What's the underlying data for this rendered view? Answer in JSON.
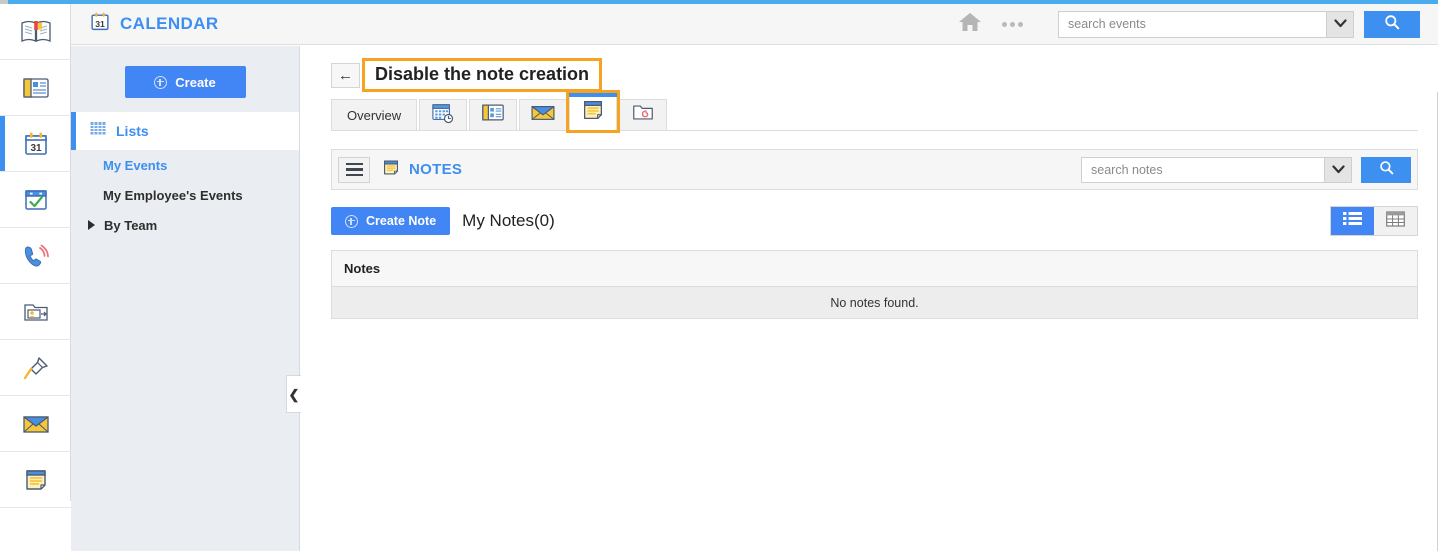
{
  "theme": {
    "accent_blue": "#3d8ff0",
    "button_blue": "#4285f4",
    "top_strip_blue": "#4aaced",
    "highlight_orange": "#f5a321",
    "sidebar_bg": "#eaedf2"
  },
  "rail": {
    "items": [
      {
        "icon": "open-book-icon",
        "active": false
      },
      {
        "icon": "news-article-icon",
        "active": false
      },
      {
        "icon": "calendar-31-icon",
        "active": true
      },
      {
        "icon": "calendar-check-icon",
        "active": false
      },
      {
        "icon": "phone-ringing-icon",
        "active": false
      },
      {
        "icon": "contact-folder-icon",
        "active": false
      },
      {
        "icon": "pushpin-icon",
        "active": false
      },
      {
        "icon": "envelope-icon",
        "active": false
      },
      {
        "icon": "notes-icon",
        "active": false
      }
    ]
  },
  "header": {
    "logo_icon": "calendar-31-icon",
    "title": "CALENDAR",
    "home_icon": "home-icon",
    "more_icon": "more-dots-icon",
    "search": {
      "placeholder": "search events",
      "value": "",
      "caret_icon": "chevron-down-icon",
      "go_icon": "search-icon"
    }
  },
  "sidebar": {
    "create_label": "Create",
    "section": {
      "icon": "grid-icon",
      "label": "Lists"
    },
    "items": [
      {
        "label": "My Events",
        "selected": true
      },
      {
        "label": "My Employee's Events",
        "selected": false
      },
      {
        "label": "By Team",
        "selected": false,
        "expandable": true
      }
    ],
    "collapse_icon": "chevron-left-icon"
  },
  "main": {
    "back_icon": "back-arrow-icon",
    "page_title": "Disable the note creation",
    "tabs": [
      {
        "label": "Overview",
        "icon": null,
        "type": "text",
        "active": false,
        "highlighted": false
      },
      {
        "label": "",
        "icon": "calendar-clock-icon",
        "type": "icon",
        "active": false,
        "highlighted": false
      },
      {
        "label": "",
        "icon": "details-list-icon",
        "type": "icon",
        "active": false,
        "highlighted": false
      },
      {
        "label": "",
        "icon": "envelope-icon",
        "type": "icon",
        "active": false,
        "highlighted": false
      },
      {
        "label": "",
        "icon": "notes-icon",
        "type": "icon",
        "active": true,
        "highlighted": true
      },
      {
        "label": "",
        "icon": "attachment-folder-icon",
        "type": "icon",
        "active": false,
        "highlighted": false
      }
    ],
    "module": {
      "burger_icon": "hamburger-menu-icon",
      "icon": "notes-icon",
      "title": "NOTES",
      "search": {
        "placeholder": "search notes",
        "value": "",
        "caret_icon": "chevron-down-icon",
        "go_icon": "search-icon"
      },
      "create_note_label": "Create Note",
      "list_heading": "My Notes(0)",
      "view_toggle": [
        {
          "icon": "list-view-icon",
          "active": true
        },
        {
          "icon": "table-view-icon",
          "active": false
        }
      ],
      "table": {
        "columns": [
          "Notes"
        ],
        "rows": [],
        "empty_message": "No notes found."
      }
    }
  }
}
